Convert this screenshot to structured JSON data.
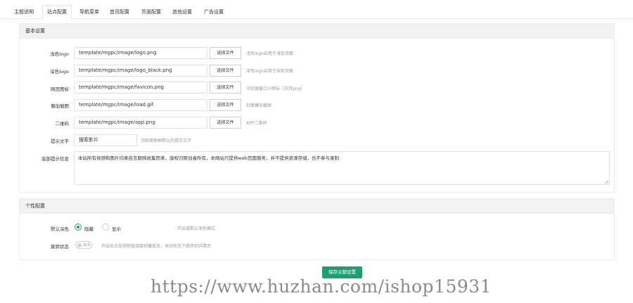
{
  "tabs": [
    "主题说明",
    "站点配置",
    "导航菜单",
    "首页配置",
    "页面配置",
    "其他设置",
    "广告设置"
  ],
  "basic": {
    "title": "基本设置",
    "rows": [
      {
        "label": "浅色logo",
        "value": "template/mgpc/image/logo.png",
        "button": "选择文件",
        "hint": "浅色logo启用于浅色页面"
      },
      {
        "label": "深色logo",
        "value": "template/mgpc/image/logo_black.png",
        "button": "选择文件",
        "hint": "深色logo启用于深色页面"
      },
      {
        "label": "网页图标",
        "value": "template/mgpc/image/favicon.png",
        "button": "选择文件",
        "hint": "浏览器窗口小图标（支持png）"
      },
      {
        "label": "懒加载图",
        "value": "template/mgpc/image/load.gif",
        "button": "选择文件",
        "hint": "封面懒加载图"
      },
      {
        "label": "二维码",
        "value": "template/mgpc/image/app.png",
        "button": "选择文件",
        "hint": "APP二维码"
      }
    ],
    "prompt": {
      "label": "提示文字",
      "value": "搜索影片",
      "hint": "顶部搜索框默认的提示文字"
    },
    "notice": {
      "label": "底部提示信息",
      "value": "本站所有视频和图片均来自互联网收集而来，版权归原创者所有，本网站只提供web页面服务，并不提供资源存储，也不参与录制"
    }
  },
  "personal": {
    "title": "个性配置",
    "theme": {
      "label": "默认深色",
      "options": [
        "隐藏",
        "显示"
      ],
      "selected": 0,
      "hint": "开启或默认深色模式"
    },
    "jump": {
      "label": "跳转状态",
      "switch_text": "关闭",
      "hint": "开启后点击视频直接跳到播放页，关闭状态下跳转到详情页"
    }
  },
  "save_label": "保存主题设置",
  "watermark": "https://www.huzhan.com/ishop15931",
  "colors": {
    "accent": "#1e9e73"
  }
}
